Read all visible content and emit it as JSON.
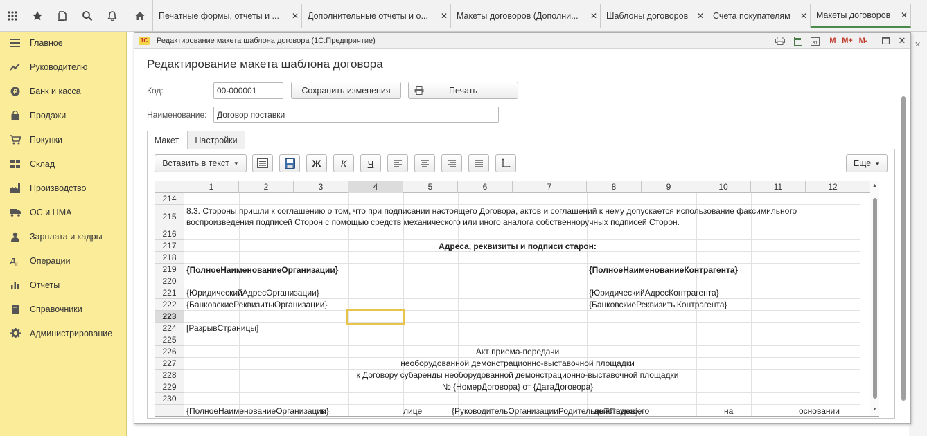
{
  "topbar": {
    "icons": [
      "apps-grid-icon",
      "star-icon",
      "history-icon",
      "search-icon",
      "bell-icon",
      "home-icon"
    ],
    "tabs": [
      {
        "label": "Печатные формы, отчеты и ...",
        "close": "✕"
      },
      {
        "label": "Дополнительные отчеты и о...",
        "close": "✕"
      },
      {
        "label": "Макеты договоров (Дополни...",
        "close": "✕"
      },
      {
        "label": "Шаблоны договоров",
        "close": "✕"
      },
      {
        "label": "Счета покупателям",
        "close": "✕"
      },
      {
        "label": "Макеты договоров",
        "close": "✕"
      }
    ]
  },
  "sidebar": {
    "items": [
      {
        "label": "Главное",
        "icon": "menu-lines-icon"
      },
      {
        "label": "Руководителю",
        "icon": "trend-chart-icon"
      },
      {
        "label": "Банк и касса",
        "icon": "ruble-coin-icon"
      },
      {
        "label": "Продажи",
        "icon": "shopping-bag-icon"
      },
      {
        "label": "Покупки",
        "icon": "cart-icon"
      },
      {
        "label": "Склад",
        "icon": "warehouse-grid-icon"
      },
      {
        "label": "Производство",
        "icon": "factory-icon"
      },
      {
        "label": "ОС и НМА",
        "icon": "truck-icon"
      },
      {
        "label": "Зарплата и кадры",
        "icon": "person-icon"
      },
      {
        "label": "Операции",
        "icon": "operations-icon"
      },
      {
        "label": "Отчеты",
        "icon": "bar-chart-icon"
      },
      {
        "label": "Справочники",
        "icon": "book-icon"
      },
      {
        "label": "Администрирование",
        "icon": "gear-icon"
      }
    ]
  },
  "window": {
    "title": "Редактирование макета шаблона договора  (1С:Предприятие)",
    "logo": "1С",
    "buttons": {
      "m": "M",
      "mplus": "M+",
      "mminus": "M-"
    },
    "form_title": "Редактирование макета шаблона договора",
    "code_label": "Код:",
    "code_value": "00-000001",
    "save_label": "Сохранить изменения",
    "print_label": "Печать",
    "name_label": "Наименование:",
    "name_value": "Договор поставки",
    "tabs": [
      "Макет",
      "Настройки"
    ],
    "toolbar": {
      "insert_label": "Вставить в текст",
      "bold": "Ж",
      "italic": "К",
      "underline": "Ч",
      "more_label": "Еще"
    }
  },
  "sheet": {
    "columns": [
      "1",
      "2",
      "3",
      "4",
      "5",
      "6",
      "7",
      "8",
      "9",
      "10",
      "11",
      "12"
    ],
    "selected_column": "4",
    "selected_row": "223",
    "rows": [
      {
        "n": "214"
      },
      {
        "n": "215",
        "cells": [
          {
            "t": "8.3. Стороны пришли к соглашению о том, что при подписании настоящего Договора, актов и соглашений к нему допускается использование факсимильного"
          },
          {
            "t": "воспроизведения подписей Сторон с помощью средств механического или иного аналога собственноручных подписей Сторон."
          }
        ]
      },
      {
        "n": "216"
      },
      {
        "n": "217",
        "cells": [
          {
            "t": "Адреса, реквизиты и подписи старон:"
          }
        ]
      },
      {
        "n": "218"
      },
      {
        "n": "219",
        "cells": [
          {
            "t": "{ПолноеНаименованиеОрганизации}"
          },
          {
            "t": "{ПолноеНаименованиеКонтрагента}"
          }
        ]
      },
      {
        "n": "220"
      },
      {
        "n": "221",
        "cells": [
          {
            "t": "{ЮридическийАдресОрганизации}"
          },
          {
            "t": "{ЮридическийАдресКонтрагента}"
          }
        ]
      },
      {
        "n": "222",
        "cells": [
          {
            "t": "{БанковскиеРеквизитыОрганизации}"
          },
          {
            "t": "{БанковскиеРеквизитыКонтрагента}"
          }
        ]
      },
      {
        "n": "223"
      },
      {
        "n": "224",
        "cells": [
          {
            "t": "[РазрывСтраницы]"
          }
        ]
      },
      {
        "n": "225"
      },
      {
        "n": "226",
        "cells": [
          {
            "t": "Акт приема-передачи"
          }
        ]
      },
      {
        "n": "227",
        "cells": [
          {
            "t": "необорудованной демонстрационно-выставочной площадки"
          }
        ]
      },
      {
        "n": "228",
        "cells": [
          {
            "t": "к Договору субаренды необорудованной демонстрационно-выставочной площадки"
          }
        ]
      },
      {
        "n": "229",
        "cells": [
          {
            "t": "№ {НомерДоговора} от {ДатаДоговора}"
          }
        ]
      },
      {
        "n": "230"
      },
      {
        "n": "",
        "cells": [
          {
            "t": "{ПолноеНаименованиеОрганизации},"
          },
          {
            "t": "в"
          },
          {
            "t": "лице"
          },
          {
            "t": "{РуководительОрганизацииРодительныйПадеж},"
          },
          {
            "t": "действующего"
          },
          {
            "t": "на"
          },
          {
            "t": "основании"
          }
        ]
      }
    ]
  },
  "colors": {
    "sidebar": "#fbec9a",
    "selection": "#e8c54a"
  }
}
